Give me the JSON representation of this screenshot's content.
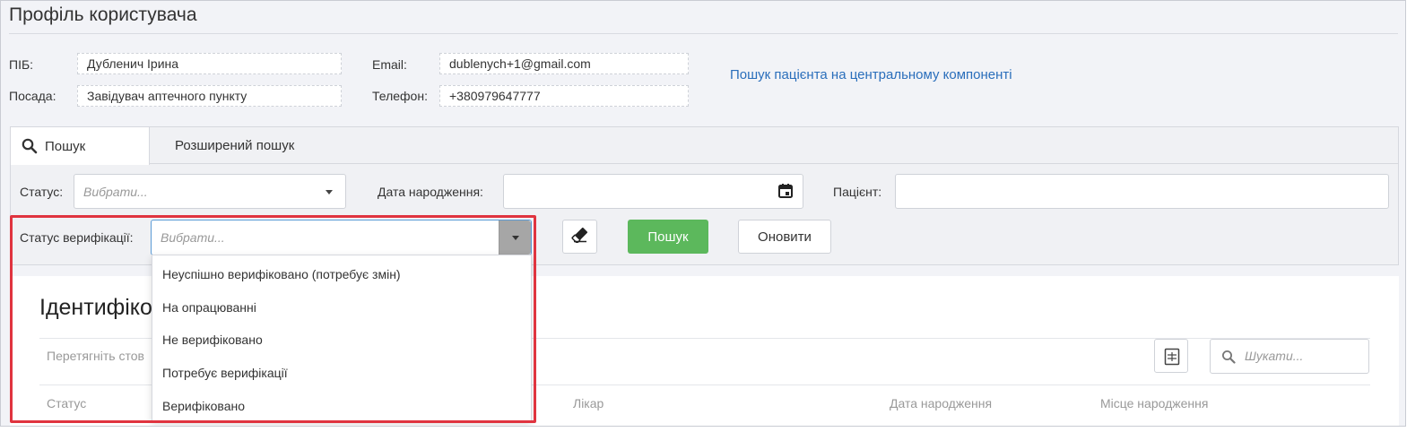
{
  "page": {
    "title": "Профіль користувача"
  },
  "profile": {
    "name_label": "ПІБ:",
    "name_value": "Дубленич Ірина",
    "position_label": "Посада:",
    "position_value": "Завідувач аптечного пункту",
    "email_label": "Email:",
    "email_value": "dublenych+1@gmail.com",
    "phone_label": "Телефон:",
    "phone_value": "+380979647777",
    "central_search_link": "Пошук пацієнта на центральному компоненті"
  },
  "tabs": [
    {
      "label": "Пошук",
      "icon": "search-icon",
      "active": true
    },
    {
      "label": "Розширений пошук",
      "active": false
    }
  ],
  "filters": {
    "status_label": "Статус:",
    "status_placeholder": "Вибрати...",
    "birthdate_label": "Дата народження:",
    "birthdate_value": "",
    "patient_label": "Пацієнт:",
    "patient_value": "",
    "verification_label": "Статус верифікації:",
    "verification_placeholder": "Вибрати...",
    "search_button": "Пошук",
    "refresh_button": "Оновити"
  },
  "verification_options": [
    "Неуспішно верифіковано (потребує змін)",
    "На опрацюванні",
    "Не верифіковано",
    "Потребує верифікації",
    "Верифіковано"
  ],
  "grid": {
    "title_visible": "Ідентифіко",
    "drag_hint_visible": "Перетягніть стов",
    "search_placeholder": "Шукати...",
    "export_icon": "xlsx-icon",
    "columns": [
      "Статус",
      "Лікар",
      "Дата народження",
      "Місце народження"
    ]
  },
  "colors": {
    "primary_button": "#5cb85c",
    "link": "#2a6ebb",
    "highlight": "#e0343f"
  }
}
